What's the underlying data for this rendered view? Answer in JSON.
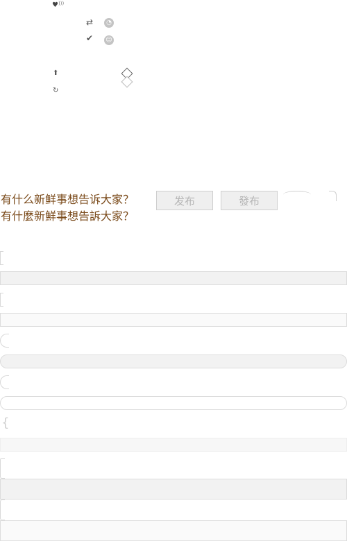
{
  "toolbar": {
    "icons": [
      "heart-signal-icon",
      "repost-icon",
      "clock-icon",
      "check-icon",
      "smile-icon",
      "upload-icon",
      "diamond-icon",
      "refresh-icon"
    ],
    "glyphs": {
      "heart": "♥",
      "repost": "⇄",
      "check": "✔",
      "upload": "⬆",
      "refresh": "↻",
      "clock": "◔",
      "smile": "☺"
    }
  },
  "composer": {
    "prompt_simplified": "有什么新鲜事想告诉大家？",
    "prompt_traditional": "有什麼新鮮事想告訴大家？",
    "publish_simplified": "发布",
    "publish_traditional": "發布"
  },
  "colors": {
    "prompt_text": "#7a4a1a",
    "button_bg": "#efefef",
    "button_text": "#b5b5b5",
    "bar_border": "#dcdcdc",
    "bar_fill_gray": "#f2f2f2",
    "bar_fill_light": "#fafafa"
  }
}
